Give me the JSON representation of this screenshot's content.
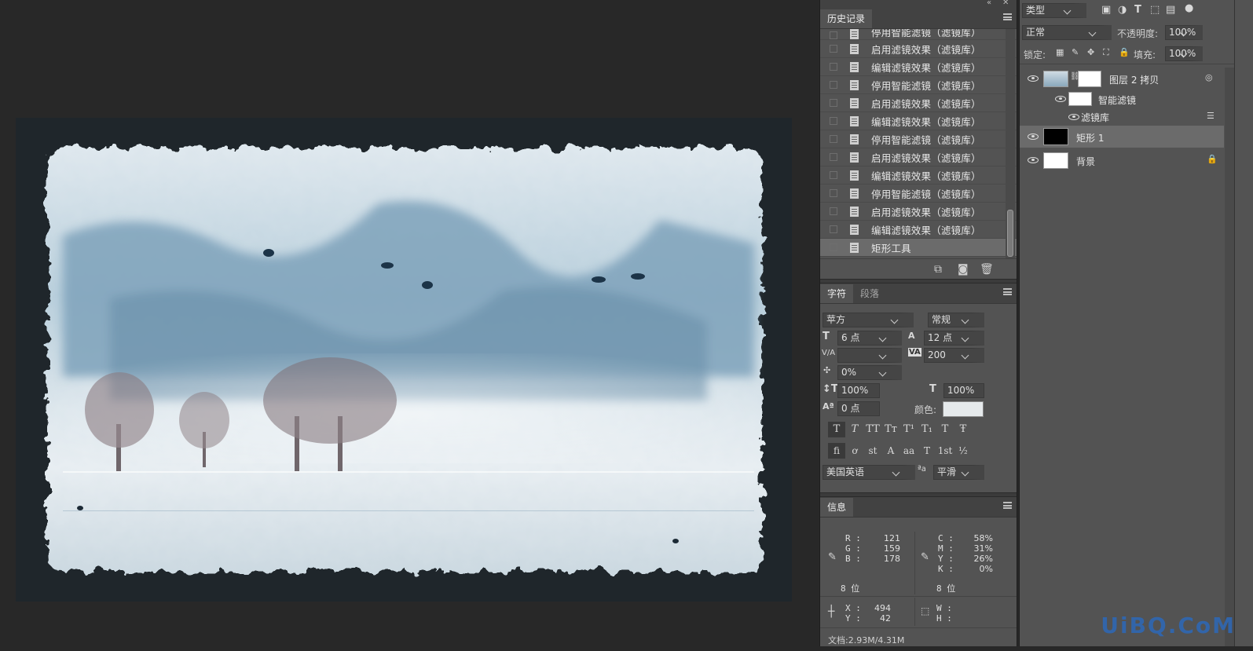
{
  "history": {
    "tab_label": "历史记录",
    "items": [
      "停用智能滤镜（滤镜库）",
      "启用滤镜效果（滤镜库）",
      "编辑滤镜效果（滤镜库）",
      "停用智能滤镜（滤镜库）",
      "启用滤镜效果（滤镜库）",
      "编辑滤镜效果（滤镜库）",
      "停用智能滤镜（滤镜库）",
      "启用滤镜效果（滤镜库）",
      "编辑滤镜效果（滤镜库）",
      "停用智能滤镜（滤镜库）",
      "启用滤镜效果（滤镜库）",
      "编辑滤镜效果（滤镜库）",
      "矩形工具"
    ]
  },
  "character": {
    "tab_label": "字符",
    "tab2_label": "段落",
    "font_family": "苹方",
    "font_style": "常规",
    "font_size": "6 点",
    "leading": "12 点",
    "kerning": "",
    "tracking": "200",
    "scale_offset": "0%",
    "vertical_scale": "100%",
    "horizontal_scale": "100%",
    "baseline_shift": "0 点",
    "color_label": "颜色:",
    "language": "美国英语",
    "aa_label": "ªa",
    "anti_alias": "平滑",
    "style_buttons": [
      "T",
      "T",
      "TT",
      "Tт",
      "T¹",
      "T₁",
      "T",
      "Ŧ"
    ],
    "opentype_buttons": [
      "ﬁ",
      "ơ",
      "st",
      "A",
      "aa",
      "T",
      "1st",
      "½"
    ],
    "text_color": "#e6eaec"
  },
  "info": {
    "tab_label": "信息",
    "rgb_labels": [
      "R :",
      "G :",
      "B :"
    ],
    "rgb_values": [
      "121",
      "159",
      "178"
    ],
    "cmyk_labels": [
      "C :",
      "M :",
      "Y :",
      "K :"
    ],
    "cmyk_values": [
      "58%",
      "31%",
      "26%",
      "0%"
    ],
    "bit_left": "8 位",
    "bit_right": "8 位",
    "x_label": "X :",
    "y_label": "Y :",
    "x_value": "494",
    "y_value": "42",
    "w_label": "W :",
    "h_label": "H :",
    "doc_size": "文档:2.93M/4.31M"
  },
  "layers": {
    "filter_kind": "类型",
    "blend_mode": "正常",
    "opacity_label": "不透明度:",
    "opacity": "100%",
    "lock_label": "锁定:",
    "fill_label": "填充:",
    "fill": "100%",
    "items": [
      {
        "name": "图层 2 拷贝"
      },
      {
        "name": "智能滤镜"
      },
      {
        "name": "滤镜库"
      },
      {
        "name": "矩形 1"
      },
      {
        "name": "背景"
      }
    ]
  },
  "watermark": "UiBQ.CoM"
}
